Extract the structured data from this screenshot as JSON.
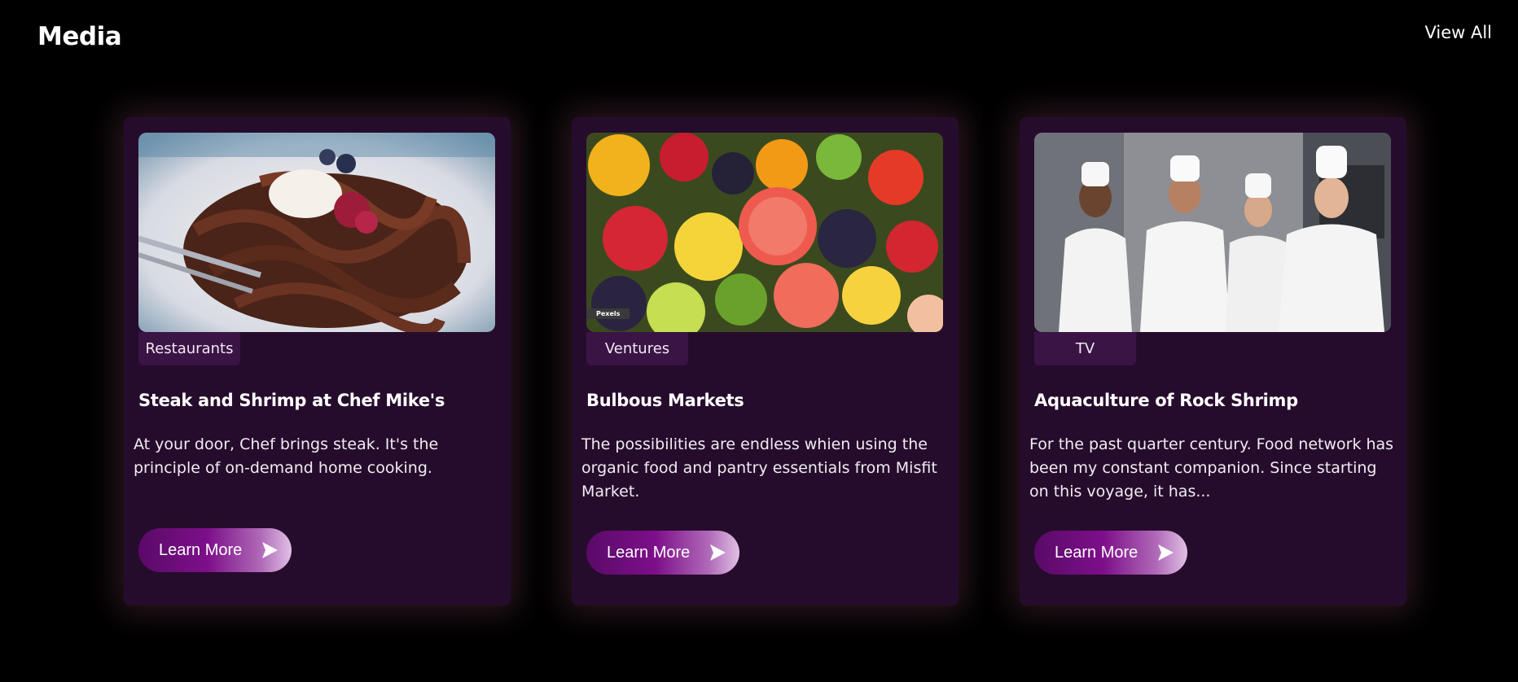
{
  "header": {
    "title": "Media",
    "view_all_label": "View All"
  },
  "colors": {
    "background": "#000000",
    "card_background": "#260c2c",
    "tag_background": "#3a1444",
    "button_gradient_start": "#5a0a68",
    "button_gradient_end": "#e0c0e4"
  },
  "cards": [
    {
      "image": "chocolate-pasta-dessert-photo",
      "tag": "Restaurants",
      "title": "Steak and Shrimp at Chef Mike's",
      "description": "At your door, Chef brings steak. It's the principle of on-demand home cooking.",
      "button_label": "Learn More",
      "button_icon": "play-arrow-icon"
    },
    {
      "image": "fruit-platter-photo",
      "image_watermark": "Pexels",
      "tag": "Ventures",
      "title": "Bulbous Markets",
      "description": "The possibilities are endless whien using the organic food and pantry essentials from Misfit Market.",
      "button_label": "Learn More",
      "button_icon": "play-arrow-icon"
    },
    {
      "image": "chefs-thumbs-up-photo",
      "tag": "TV",
      "title": "Aquaculture of Rock Shrimp",
      "description": "For the past quarter century. Food network has been my constant companion. Since starting on this voyage, it has...",
      "button_label": "Learn More",
      "button_icon": "play-arrow-icon"
    }
  ]
}
